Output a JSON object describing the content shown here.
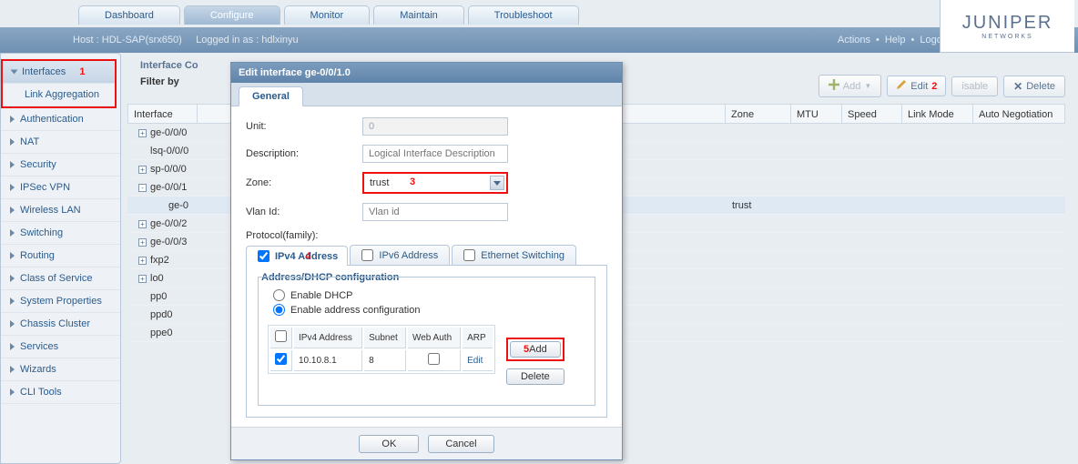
{
  "brand": {
    "name": "JUNIPER",
    "sub": "NETWORKS"
  },
  "tabs": [
    "Dashboard",
    "Configure",
    "Monitor",
    "Maintain",
    "Troubleshoot"
  ],
  "active_tab": 1,
  "status": {
    "host": "Host : HDL-SAP(srx650)",
    "login": "Logged in as : hdlxinyu",
    "actions": "Actions",
    "help": "Help",
    "logout": "Logout"
  },
  "sidebar": {
    "interfaces": "Interfaces",
    "link_agg": "Link Aggregation",
    "items": [
      "Authentication",
      "NAT",
      "Security",
      "IPSec VPN",
      "Wireless LAN",
      "Switching",
      "Routing",
      "Class of Service",
      "System Properties",
      "Chassis Cluster",
      "Services",
      "Wizards",
      "CLI Tools"
    ]
  },
  "annot": {
    "n1": "1",
    "n2": "2",
    "n3": "3",
    "n4": "4",
    "n5": "5"
  },
  "content_header": {
    "title": "Interface Co",
    "filter": "Filter by"
  },
  "toolbar": {
    "add": "Add",
    "edit": "Edit",
    "disable": "isable",
    "delete": "Delete"
  },
  "columns": {
    "iface": "Interface",
    "zone": "Zone",
    "mtu": "MTU",
    "speed": "Speed",
    "linkmode": "Link Mode",
    "autoneg": "Auto Negotiation"
  },
  "rows": [
    {
      "icon": "+",
      "name": "ge-0/0/0"
    },
    {
      "icon": "",
      "name": "lsq-0/0/0"
    },
    {
      "icon": "+",
      "name": "sp-0/0/0"
    },
    {
      "icon": "-",
      "name": "ge-0/0/1"
    },
    {
      "icon": "",
      "name": "ge-0",
      "zone": "trust",
      "sel": true
    },
    {
      "icon": "+",
      "name": "ge-0/0/2"
    },
    {
      "icon": "+",
      "name": "ge-0/0/3"
    },
    {
      "icon": "+",
      "name": "fxp2"
    },
    {
      "icon": "+",
      "name": "lo0"
    },
    {
      "icon": "",
      "name": "pp0"
    },
    {
      "icon": "",
      "name": "ppd0"
    },
    {
      "icon": "",
      "name": "ppe0"
    }
  ],
  "modal": {
    "title": "Edit interface ge-0/0/1.0",
    "tab": "General",
    "labels": {
      "unit": "Unit:",
      "desc": "Description:",
      "zone": "Zone:",
      "vlan": "Vlan Id:",
      "proto": "Protocol(family):"
    },
    "values": {
      "unit": "0",
      "desc_ph": "Logical Interface Description",
      "zone": "trust",
      "vlan_ph": "Vlan id"
    },
    "proto_tabs": {
      "ipv4": "IPv4 Address",
      "ipv6": "IPv6 Address",
      "eth": "Ethernet Switching"
    },
    "fs_title": "Address/DHCP configuration",
    "radios": {
      "dhcp": "Enable DHCP",
      "addr": "Enable address configuration"
    },
    "addr_cols": {
      "ip": "IPv4 Address",
      "subnet": "Subnet",
      "web": "Web Auth",
      "arp": "ARP"
    },
    "addr_row": {
      "ip": "10.10.8.1",
      "subnet": "8",
      "arp": "Edit"
    },
    "btn": {
      "add": "Add",
      "del": "Delete",
      "ok": "OK",
      "cancel": "Cancel"
    }
  }
}
